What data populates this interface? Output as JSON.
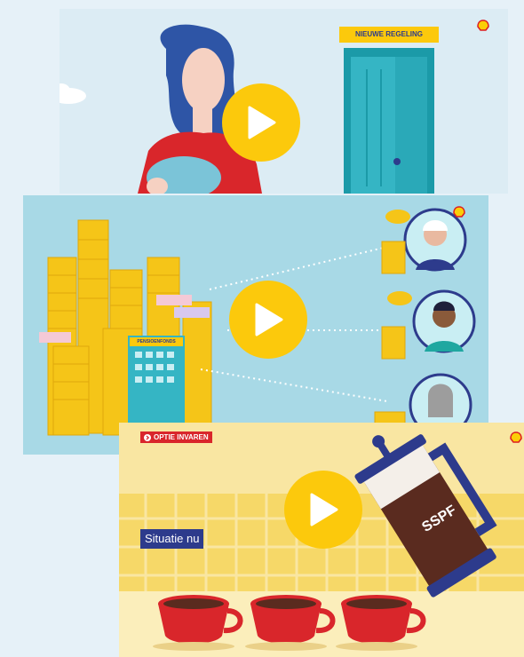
{
  "cards": [
    {
      "label": "NIEUWE REGELING",
      "play_icon": "play-icon",
      "logo_icon": "shell-logo-icon"
    },
    {
      "building_label": "PENSIOENFONDS",
      "play_icon": "play-icon",
      "logo_icon": "shell-logo-icon"
    },
    {
      "tag": "OPTIE INVAREN",
      "tag_icon": "chevron-right-icon",
      "situation_label": "Situatie nu",
      "pot_label": "SSPF",
      "play_icon": "play-icon",
      "logo_icon": "shell-logo-icon"
    }
  ],
  "colors": {
    "play": "#fcc90c",
    "shell_red": "#dd1d21",
    "shell_yellow": "#fbce07",
    "navy": "#2d3b8c"
  }
}
